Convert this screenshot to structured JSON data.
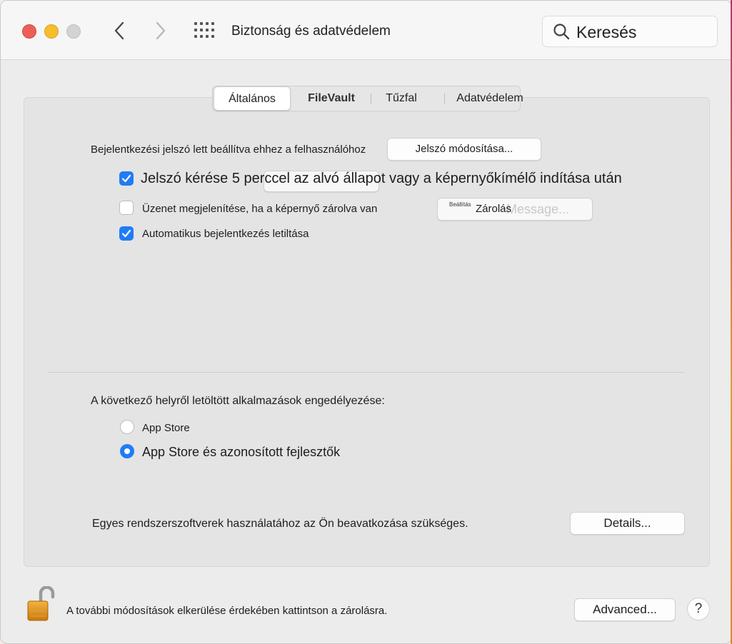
{
  "window": {
    "title": "Biztonság és adatvédelem",
    "search_placeholder": "Keresés"
  },
  "tabs": [
    {
      "label": "Általános",
      "active": true
    },
    {
      "label": "FileVault",
      "active": false
    },
    {
      "label": "Tűzfal",
      "active": false
    },
    {
      "label": "Adatvédelem",
      "active": false
    }
  ],
  "general": {
    "password_set_text": "Bejelentkezési jelszó lett beállítva ehhez a felhasználóhoz",
    "change_password_button": "Jelszó módosítása...",
    "require_password": {
      "label": "Jelszó kérése 5 perccel az alvó állapot vagy a képernyőkímélő indítása után",
      "checked": true
    },
    "show_message": {
      "label": "Üzenet megjelenítése, ha a képernyő zárolva van",
      "checked": false
    },
    "lock_message_button": {
      "small_label": "Beállítás",
      "label": "Zárolás",
      "ghost_label": "Message..."
    },
    "disable_auto_login": {
      "label": "Automatikus bejelentkezés letiltása",
      "checked": true
    }
  },
  "downloads": {
    "heading": "A következő helyről letöltött alkalmazások engedélyezése:",
    "options": [
      {
        "label": "App Store",
        "selected": false
      },
      {
        "label": "App Store és azonosított fejlesztők",
        "selected": true
      }
    ]
  },
  "system_software": {
    "text": "Egyes rendszerszoftverek használatához az Ön beavatkozása szükséges.",
    "details_button": "Details..."
  },
  "footer": {
    "lock_text": "A további módosítások elkerülése érdekében kattintson a zárolásra.",
    "advanced_button": "Advanced...",
    "help_button": "?"
  },
  "colors": {
    "accent": "#1f7cf6",
    "close": "#ec5f57",
    "minimize": "#f4be2f",
    "zoom_inactive": "#d3d3d3"
  }
}
